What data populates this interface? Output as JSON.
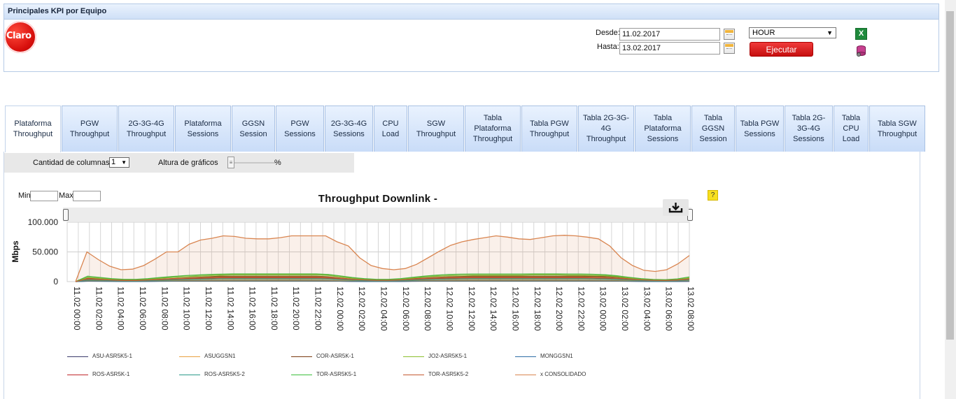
{
  "header": {
    "title": "Principales KPI por Equipo",
    "logo_text": "Claro"
  },
  "filters": {
    "desde_label": "Desde:",
    "hasta_label": "Hasta:",
    "desde_value": "11.02.2017",
    "hasta_value": "13.02.2017",
    "granularity": "HOUR",
    "run_label": "Ejecutar",
    "export_icon": "excel-icon",
    "db_icon": "database-icon"
  },
  "tabs": [
    {
      "label": "Plataforma Throughput",
      "active": true
    },
    {
      "label": "PGW Throughput"
    },
    {
      "label": "2G-3G-4G Throughput"
    },
    {
      "label": "Plataforma Sessions"
    },
    {
      "label": "GGSN Session"
    },
    {
      "label": "PGW Sessions"
    },
    {
      "label": "2G-3G-4G Sessions"
    },
    {
      "label": "CPU Load"
    },
    {
      "label": "SGW Throughput"
    },
    {
      "label": "Tabla Plataforma Throughput"
    },
    {
      "label": "Tabla PGW Throughput"
    },
    {
      "label": "Tabla 2G-3G-4G Throughput"
    },
    {
      "label": "Tabla Plataforma Sessions"
    },
    {
      "label": "Tabla GGSN Session"
    },
    {
      "label": "Tabla PGW Sessions"
    },
    {
      "label": "Tabla 2G-3G-4G Sessions"
    },
    {
      "label": "Tabla CPU Load"
    },
    {
      "label": "Tabla SGW Throughput"
    }
  ],
  "toolbar": {
    "columns_label": "Cantidad de columnas",
    "columns_value": "1",
    "height_label": "Altura de gráficos",
    "percent_label": "%"
  },
  "minmax": {
    "min_label": "Min",
    "max_label": "Max"
  },
  "help_label": "?",
  "chart_data": {
    "type": "area",
    "title": "Throughput Downlink -",
    "ylabel": "Mbps",
    "xlabel": "",
    "ylim": [
      0,
      100000
    ],
    "yticks": [
      "0",
      "50.000",
      "100.000"
    ],
    "grid": true,
    "legend": "bottom",
    "x_tick_labels": [
      "11.02 00:00",
      "11.02 02:00",
      "11.02 04:00",
      "11.02 06:00",
      "11.02 08:00",
      "11.02 10:00",
      "11.02 12:00",
      "11.02 14:00",
      "11.02 16:00",
      "11.02 18:00",
      "11.02 20:00",
      "11.02 22:00",
      "12.02 00:00",
      "12.02 02:00",
      "12.02 04:00",
      "12.02 06:00",
      "12.02 08:00",
      "12.02 10:00",
      "12.02 12:00",
      "12.02 14:00",
      "12.02 16:00",
      "12.02 18:00",
      "12.02 20:00",
      "12.02 22:00",
      "13.02 00:00",
      "13.02 02:00",
      "13.02 04:00",
      "13.02 06:00",
      "13.02 08:00"
    ],
    "series": [
      {
        "name": "ASU-ASR5K5-1",
        "color": "#3b3b6b",
        "values": [
          0,
          1000,
          800,
          600,
          400,
          400,
          500,
          700,
          800,
          900,
          1000,
          1000,
          1000,
          1000,
          1000,
          1000,
          1000,
          1100,
          1100,
          1100,
          1000,
          900,
          700,
          500,
          400,
          300,
          300,
          400,
          600,
          800,
          900,
          1000,
          1000,
          1000,
          1000,
          1000,
          1000,
          1000,
          1000,
          1000,
          1000,
          1000,
          1000,
          1000,
          1000,
          900,
          700,
          500,
          300,
          300,
          400,
          500
        ]
      },
      {
        "name": "ASUGGSN1",
        "color": "#e8a040",
        "values": [
          0,
          1500,
          1200,
          900,
          700,
          600,
          800,
          1100,
          1300,
          1500,
          1700,
          1800,
          1900,
          1900,
          1900,
          1900,
          1900,
          2000,
          2000,
          2000,
          1900,
          1700,
          1300,
          900,
          700,
          600,
          600,
          700,
          1100,
          1500,
          1700,
          1900,
          2000,
          2000,
          2000,
          2000,
          2000,
          2000,
          2000,
          2000,
          2000,
          1900,
          1900,
          1800,
          1700,
          1500,
          1200,
          900,
          700,
          600,
          700,
          1000
        ]
      },
      {
        "name": "COR-ASR5K-1",
        "color": "#7a3a10",
        "values": [
          0,
          6000,
          4500,
          3000,
          2000,
          2000,
          3000,
          4000,
          5000,
          6000,
          7000,
          8000,
          9000,
          9000,
          9000,
          9000,
          9000,
          9000,
          9000,
          9000,
          9000,
          8000,
          6000,
          4000,
          3000,
          2000,
          2000,
          3000,
          5000,
          6000,
          7000,
          8000,
          8500,
          9000,
          9000,
          9000,
          9000,
          9000,
          9000,
          9000,
          9000,
          9000,
          9000,
          9000,
          8500,
          7500,
          5500,
          4000,
          2500,
          2000,
          3000,
          5000
        ]
      },
      {
        "name": "JO2-ASR5K5-1",
        "color": "#8cbf2e",
        "values": [
          0,
          7000,
          5500,
          4000,
          3000,
          3000,
          4000,
          5500,
          7000,
          8000,
          9000,
          10000,
          11000,
          11500,
          11500,
          11500,
          11500,
          11500,
          11500,
          11500,
          11500,
          10500,
          8000,
          5500,
          4000,
          3000,
          3000,
          4000,
          6000,
          8000,
          9000,
          10000,
          10500,
          11000,
          11000,
          11000,
          11000,
          11000,
          11500,
          11500,
          11500,
          11000,
          11000,
          10500,
          10000,
          8500,
          6000,
          4000,
          3000,
          2500,
          3500,
          6000
        ]
      },
      {
        "name": "MONGGSN1",
        "color": "#2e6ea6",
        "values": [
          0,
          800,
          600,
          500,
          400,
          400,
          500,
          600,
          700,
          800,
          900,
          900,
          1000,
          1000,
          1000,
          1000,
          1000,
          1000,
          1000,
          1000,
          1000,
          900,
          700,
          500,
          400,
          400,
          400,
          500,
          700,
          800,
          900,
          900,
          1000,
          1000,
          1000,
          1000,
          1000,
          1000,
          1000,
          1000,
          1000,
          1000,
          1000,
          900,
          900,
          800,
          600,
          500,
          400,
          400,
          500,
          700
        ]
      },
      {
        "name": "ROS-ASR5K-1",
        "color": "#c0262a",
        "values": [
          0,
          4000,
          3000,
          2200,
          1600,
          1600,
          2200,
          3000,
          3800,
          4500,
          5200,
          5800,
          6300,
          6500,
          6500,
          6500,
          6500,
          6500,
          6500,
          6500,
          6500,
          6000,
          4600,
          3200,
          2300,
          1800,
          1800,
          2300,
          3400,
          4400,
          5200,
          5800,
          6200,
          6400,
          6400,
          6400,
          6400,
          6400,
          6400,
          6400,
          6400,
          6400,
          6400,
          6200,
          5800,
          5000,
          3700,
          2600,
          1800,
          1600,
          2200,
          3800
        ]
      },
      {
        "name": "ROS-ASR5K5-2",
        "color": "#2a9a8a",
        "values": [
          0,
          3000,
          2300,
          1700,
          1200,
          1200,
          1700,
          2300,
          2900,
          3500,
          4000,
          4400,
          4800,
          5000,
          5000,
          5000,
          5000,
          5000,
          5000,
          5000,
          5000,
          4600,
          3500,
          2500,
          1800,
          1400,
          1400,
          1800,
          2600,
          3400,
          4000,
          4400,
          4700,
          4900,
          4900,
          4900,
          4900,
          4900,
          4900,
          4900,
          4900,
          4900,
          4900,
          4700,
          4400,
          3800,
          2800,
          2000,
          1400,
          1200,
          1700,
          2900
        ]
      },
      {
        "name": "TOR-ASR5K5-1",
        "color": "#3cbf3c",
        "values": [
          0,
          9000,
          7000,
          5000,
          3800,
          3800,
          5000,
          6800,
          8500,
          10000,
          11000,
          12000,
          12500,
          13000,
          13000,
          13000,
          13000,
          13000,
          13000,
          13000,
          13000,
          12000,
          9500,
          6800,
          5000,
          3800,
          3800,
          5000,
          7200,
          9200,
          10800,
          12000,
          12500,
          12800,
          12800,
          12800,
          12800,
          12800,
          13000,
          13000,
          13000,
          12800,
          12800,
          12300,
          11500,
          9800,
          7200,
          5000,
          3600,
          3200,
          4600,
          7800
        ]
      },
      {
        "name": "TOR-ASR5K5-2",
        "color": "#c45a30",
        "values": [
          0,
          5000,
          3800,
          2800,
          2000,
          2000,
          2800,
          3800,
          4800,
          5600,
          6400,
          7000,
          7500,
          7800,
          7800,
          7800,
          7800,
          7800,
          7800,
          7800,
          7800,
          7200,
          5600,
          4000,
          2900,
          2200,
          2200,
          2900,
          4200,
          5400,
          6400,
          7000,
          7400,
          7600,
          7600,
          7600,
          7600,
          7600,
          7600,
          7600,
          7600,
          7600,
          7600,
          7300,
          6800,
          5900,
          4400,
          3100,
          2200,
          1900,
          2700,
          4600
        ]
      },
      {
        "name": "x CONSOLIDADO",
        "color": "#d98550",
        "values": [
          0,
          50000,
          37000,
          26000,
          20000,
          21000,
          27000,
          38000,
          50000,
          50000,
          63000,
          70000,
          73000,
          77000,
          76000,
          73000,
          72000,
          72000,
          74000,
          77000,
          77000,
          77000,
          77000,
          67000,
          60000,
          40000,
          27000,
          22000,
          20000,
          22000,
          29000,
          40000,
          51000,
          61000,
          67000,
          71000,
          74000,
          77000,
          75000,
          72000,
          71000,
          74000,
          77000,
          78000,
          77000,
          75000,
          72000,
          60000,
          40000,
          27000,
          19000,
          17000,
          20000,
          30000,
          44000
        ]
      }
    ]
  }
}
